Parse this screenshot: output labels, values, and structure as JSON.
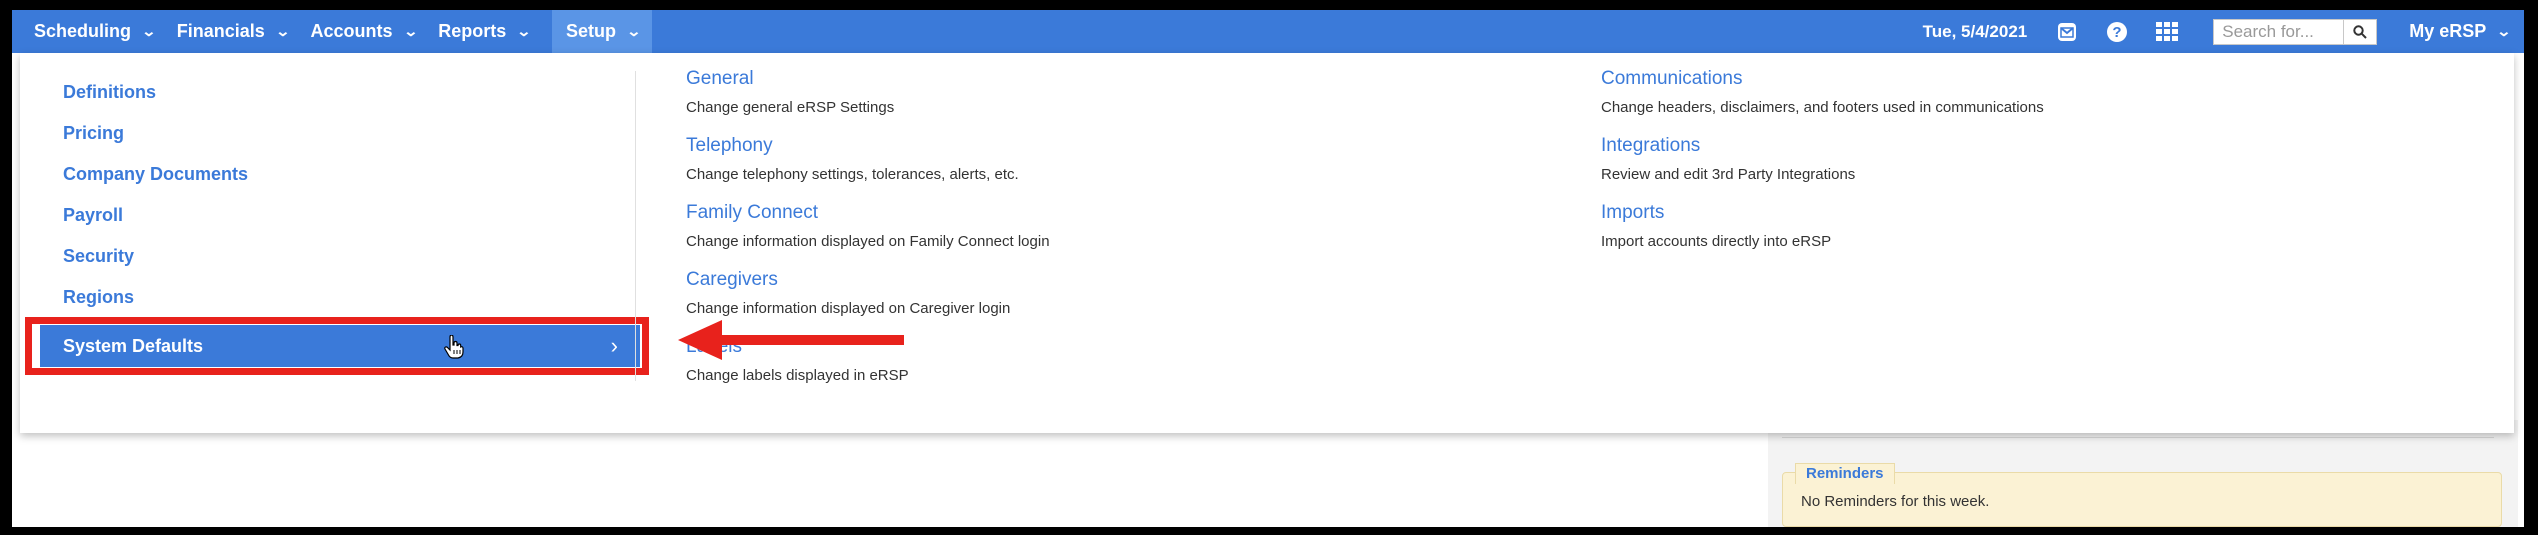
{
  "nav": {
    "items": [
      {
        "label": "Scheduling"
      },
      {
        "label": "Financials"
      },
      {
        "label": "Accounts"
      },
      {
        "label": "Reports"
      },
      {
        "label": "Setup",
        "active": true
      }
    ],
    "date": "Tue, 5/4/2021",
    "search_placeholder": "Search for...",
    "account_label": "My eRSP",
    "icons": [
      "envelope-icon",
      "help-icon",
      "grid-icon",
      "search-icon"
    ],
    "colors": {
      "bar": "#3b7ad9",
      "active": "#5a95e6"
    }
  },
  "setup_menu": {
    "left_items": [
      {
        "label": "Definitions"
      },
      {
        "label": "Pricing"
      },
      {
        "label": "Company Documents"
      },
      {
        "label": "Payroll"
      },
      {
        "label": "Security"
      },
      {
        "label": "Regions"
      }
    ],
    "selected_item": {
      "label": "System Defaults",
      "arrow": "›"
    },
    "middle_column": [
      {
        "title": "General",
        "description": "Change general eRSP Settings"
      },
      {
        "title": "Telephony",
        "description": "Change telephony settings, tolerances, alerts, etc."
      },
      {
        "title": "Family Connect",
        "description": "Change information displayed on Family Connect login"
      },
      {
        "title": "Caregivers",
        "description": "Change information displayed on Caregiver login"
      },
      {
        "title": "Labels",
        "description": "Change labels displayed in eRSP"
      }
    ],
    "right_column": [
      {
        "title": "Communications",
        "description": "Change headers, disclaimers, and footers used in communications"
      },
      {
        "title": "Integrations",
        "description": "Review and edit 3rd Party Integrations"
      },
      {
        "title": "Imports",
        "description": "Import accounts directly into eRSP"
      }
    ]
  },
  "reminders": {
    "title": "Reminders",
    "message": "No Reminders for this week."
  },
  "annotation": {
    "highlight_color": "#e8221c"
  }
}
